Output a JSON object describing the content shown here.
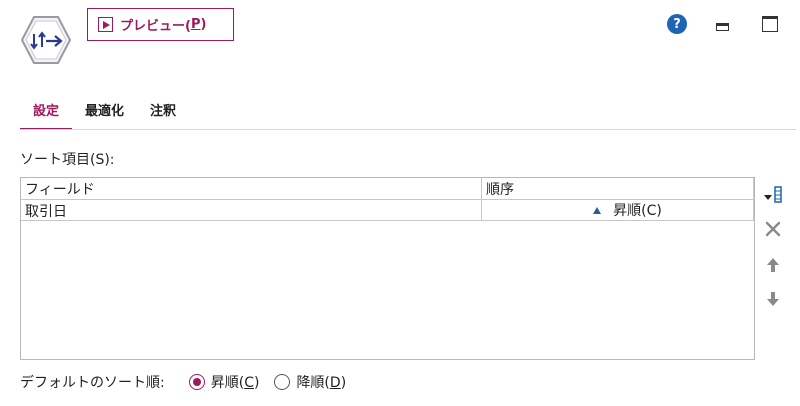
{
  "header": {
    "preview_label": "プレビュー(",
    "preview_key": "P",
    "preview_close": ")",
    "help_glyph": "?"
  },
  "tabs": [
    {
      "label": "設定",
      "active": true
    },
    {
      "label": "最適化",
      "active": false
    },
    {
      "label": "注釈",
      "active": false
    }
  ],
  "sort": {
    "label": "ソート項目(S):",
    "columns": {
      "field": "フィールド",
      "order": "順序"
    },
    "rows": [
      {
        "field": "取引日",
        "order": "昇順(C)"
      }
    ]
  },
  "default_order": {
    "label": "デフォルトのソート順:",
    "asc_label": "昇順(",
    "asc_key": "C",
    "desc_label": "降順(",
    "desc_key": "D",
    "close": ")",
    "selected": "asc"
  },
  "colors": {
    "accent": "#a0195d",
    "help": "#1e64b4",
    "sort_arrow": "#2a5d8f"
  }
}
